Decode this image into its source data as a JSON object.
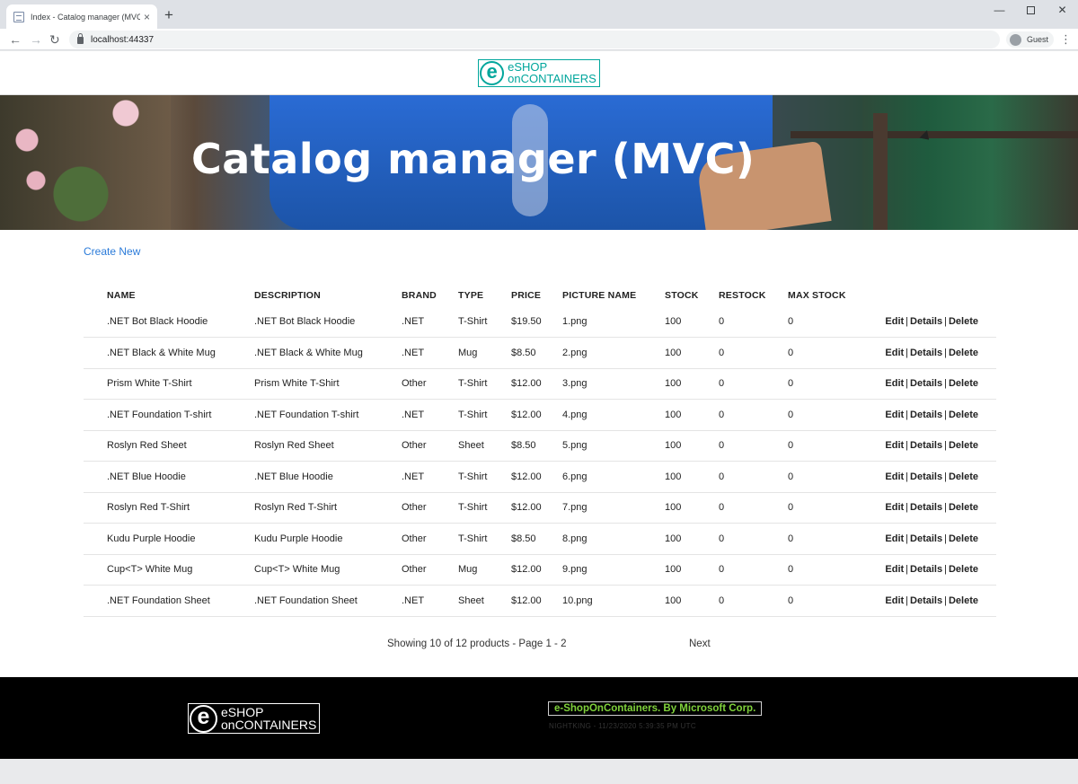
{
  "browser": {
    "tab_title": "Index - Catalog manager (MVC)",
    "tab_close": "×",
    "new_tab": "+",
    "back": "←",
    "forward": "→",
    "reload": "↻",
    "url": "localhost:44337",
    "profile_label": "Guest",
    "menu": "⋮",
    "window_minimize": "—",
    "window_close": "✕"
  },
  "header": {
    "logo_line1": "eSHOP",
    "logo_line2": "onCONTAINERS",
    "logo_letter": "e"
  },
  "hero": {
    "title": "Catalog manager (MVC)"
  },
  "actions": {
    "create_new": "Create New"
  },
  "table": {
    "headers": [
      "NAME",
      "DESCRIPTION",
      "BRAND",
      "TYPE",
      "PRICE",
      "PICTURE NAME",
      "STOCK",
      "RESTOCK",
      "MAX STOCK"
    ],
    "row_actions": {
      "edit": "Edit",
      "details": "Details",
      "delete": "Delete",
      "separator": "|"
    },
    "rows": [
      {
        "name": ".NET Bot Black Hoodie",
        "description": ".NET Bot Black Hoodie",
        "brand": ".NET",
        "type": "T-Shirt",
        "price": "$19.50",
        "picture": "1.png",
        "stock": "100",
        "restock": "0",
        "max_stock": "0"
      },
      {
        "name": ".NET Black & White Mug",
        "description": ".NET Black & White Mug",
        "brand": ".NET",
        "type": "Mug",
        "price": "$8.50",
        "picture": "2.png",
        "stock": "100",
        "restock": "0",
        "max_stock": "0"
      },
      {
        "name": "Prism White T-Shirt",
        "description": "Prism White T-Shirt",
        "brand": "Other",
        "type": "T-Shirt",
        "price": "$12.00",
        "picture": "3.png",
        "stock": "100",
        "restock": "0",
        "max_stock": "0"
      },
      {
        "name": ".NET Foundation T-shirt",
        "description": ".NET Foundation T-shirt",
        "brand": ".NET",
        "type": "T-Shirt",
        "price": "$12.00",
        "picture": "4.png",
        "stock": "100",
        "restock": "0",
        "max_stock": "0"
      },
      {
        "name": "Roslyn Red Sheet",
        "description": "Roslyn Red Sheet",
        "brand": "Other",
        "type": "Sheet",
        "price": "$8.50",
        "picture": "5.png",
        "stock": "100",
        "restock": "0",
        "max_stock": "0"
      },
      {
        "name": ".NET Blue Hoodie",
        "description": ".NET Blue Hoodie",
        "brand": ".NET",
        "type": "T-Shirt",
        "price": "$12.00",
        "picture": "6.png",
        "stock": "100",
        "restock": "0",
        "max_stock": "0"
      },
      {
        "name": "Roslyn Red T-Shirt",
        "description": "Roslyn Red T-Shirt",
        "brand": "Other",
        "type": "T-Shirt",
        "price": "$12.00",
        "picture": "7.png",
        "stock": "100",
        "restock": "0",
        "max_stock": "0"
      },
      {
        "name": "Kudu Purple Hoodie",
        "description": "Kudu Purple Hoodie",
        "brand": "Other",
        "type": "T-Shirt",
        "price": "$8.50",
        "picture": "8.png",
        "stock": "100",
        "restock": "0",
        "max_stock": "0"
      },
      {
        "name": "Cup<T> White Mug",
        "description": "Cup<T> White Mug",
        "brand": "Other",
        "type": "Mug",
        "price": "$12.00",
        "picture": "9.png",
        "stock": "100",
        "restock": "0",
        "max_stock": "0"
      },
      {
        "name": ".NET Foundation Sheet",
        "description": ".NET Foundation Sheet",
        "brand": ".NET",
        "type": "Sheet",
        "price": "$12.00",
        "picture": "10.png",
        "stock": "100",
        "restock": "0",
        "max_stock": "0"
      }
    ]
  },
  "pager": {
    "summary": "Showing 10 of 12 products - Page 1 - 2",
    "next": "Next"
  },
  "footer": {
    "logo_letter": "e",
    "logo_line1": "eSHOP",
    "logo_line2": "onCONTAINERS",
    "credit": "e-ShopOnContainers. By Microsoft Corp.",
    "meta": "NIGHTKING - 11/23/2020 5:39:35 PM UTC"
  },
  "colors": {
    "brand_teal": "#00a69c",
    "link_blue": "#2b7bd9",
    "footer_bg": "#000000",
    "credit_green": "#7fd13b"
  }
}
